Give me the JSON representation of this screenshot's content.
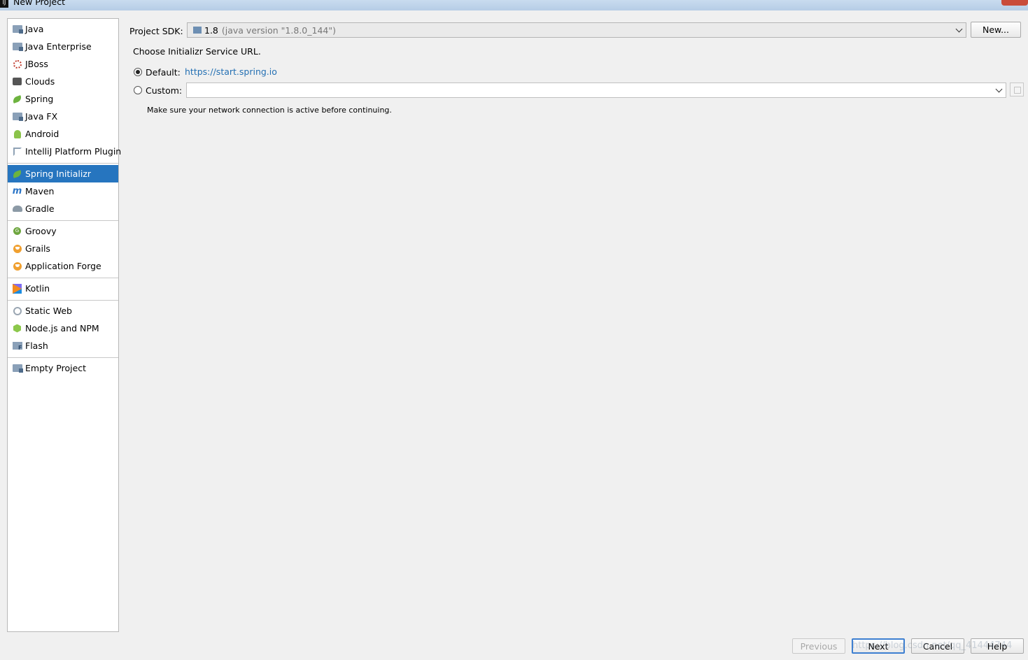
{
  "window": {
    "title": "New Project"
  },
  "sidebar": {
    "groups": [
      [
        {
          "label": "Java",
          "icon": "folder-icon"
        },
        {
          "label": "Java Enterprise",
          "icon": "folder-icon"
        },
        {
          "label": "JBoss",
          "icon": "jboss-icon"
        },
        {
          "label": "Clouds",
          "icon": "cloud-icon"
        },
        {
          "label": "Spring",
          "icon": "spring-leaf-icon"
        },
        {
          "label": "Java FX",
          "icon": "folder-icon"
        },
        {
          "label": "Android",
          "icon": "android-icon"
        },
        {
          "label": "IntelliJ Platform Plugin",
          "icon": "plugin-icon"
        }
      ],
      [
        {
          "label": "Spring Initializr",
          "icon": "spring-initializr-icon",
          "selected": true
        },
        {
          "label": "Maven",
          "icon": "maven-icon"
        },
        {
          "label": "Gradle",
          "icon": "gradle-icon"
        }
      ],
      [
        {
          "label": "Groovy",
          "icon": "groovy-icon"
        },
        {
          "label": "Grails",
          "icon": "grails-icon"
        },
        {
          "label": "Application Forge",
          "icon": "grails-icon"
        }
      ],
      [
        {
          "label": "Kotlin",
          "icon": "kotlin-icon"
        }
      ],
      [
        {
          "label": "Static Web",
          "icon": "web-icon"
        },
        {
          "label": "Node.js and NPM",
          "icon": "nodejs-icon"
        },
        {
          "label": "Flash",
          "icon": "flash-icon"
        }
      ],
      [
        {
          "label": "Empty Project",
          "icon": "folder-icon"
        }
      ]
    ]
  },
  "main": {
    "sdk_label": "Project SDK:",
    "sdk_version": "1.8",
    "sdk_detail": "(java version \"1.8.0_144\")",
    "new_button": "New...",
    "choose_url_label": "Choose Initializr Service URL.",
    "default_label": "Default:",
    "default_url": "https://start.spring.io",
    "custom_label": "Custom:",
    "custom_value": "",
    "network_note": "Make sure your network connection is active before continuing."
  },
  "footer": {
    "previous": "Previous",
    "next": "Next",
    "cancel": "Cancel",
    "help": "Help"
  },
  "watermark": "https://blog.csdn.net/qq_41444744"
}
